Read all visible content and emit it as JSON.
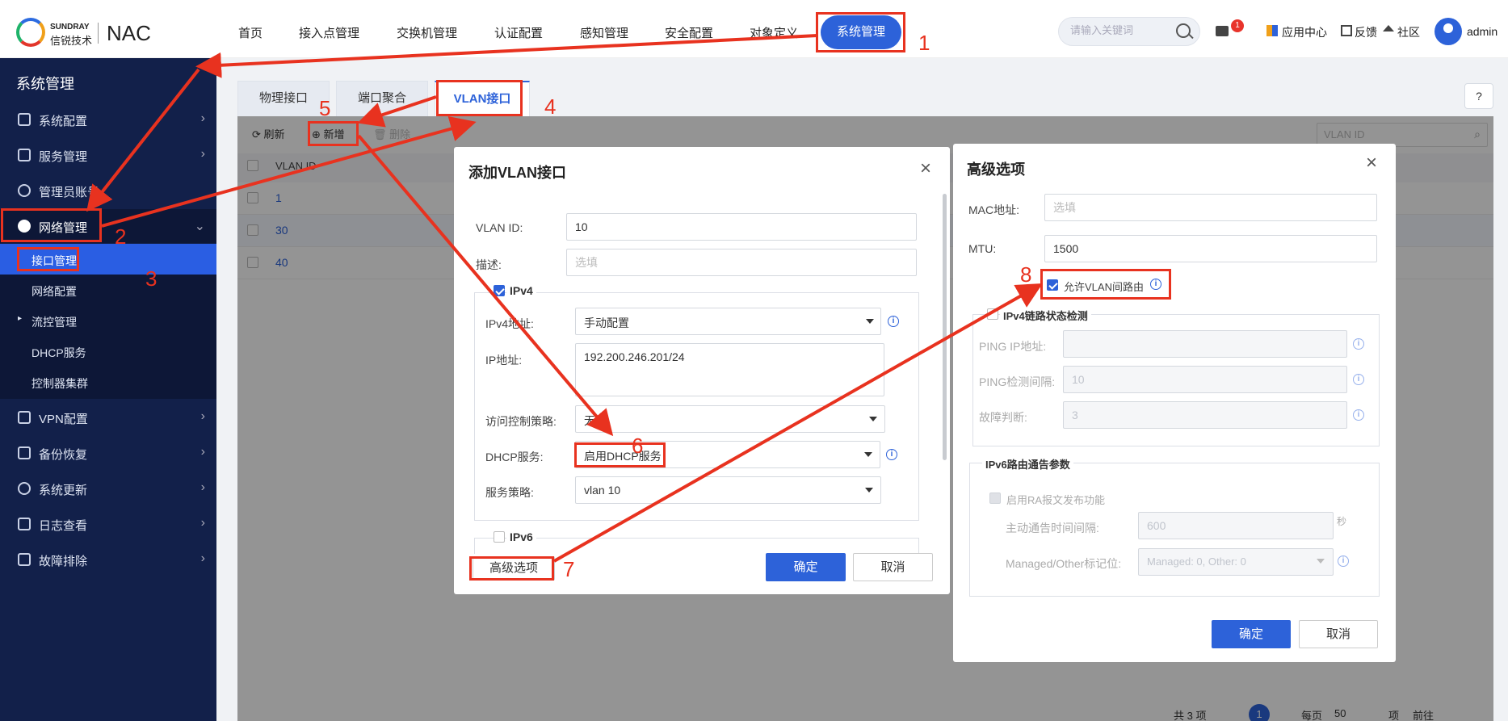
{
  "header": {
    "brand_en": "SUNDRAY",
    "brand_cn": "信锐技术",
    "product": "NAC",
    "nav": [
      "首页",
      "接入点管理",
      "交换机管理",
      "认证配置",
      "感知管理",
      "安全配置",
      "对象定义",
      "系统管理"
    ],
    "active_nav": "系统管理",
    "search_placeholder": "请输入关键词",
    "message_count": "1",
    "app_center": "应用中心",
    "feedback": "反馈",
    "community": "社区",
    "user": "admin"
  },
  "sidebar": {
    "title": "系统管理",
    "items": [
      {
        "label": "系统配置",
        "icon": "settings-icon"
      },
      {
        "label": "服务管理",
        "icon": "server-icon"
      },
      {
        "label": "管理员账号",
        "icon": "user-icon"
      },
      {
        "label": "网络管理",
        "icon": "network-icon"
      },
      {
        "label": "VPN配置",
        "icon": "vpn-icon"
      },
      {
        "label": "备份恢复",
        "icon": "backup-icon"
      },
      {
        "label": "系统更新",
        "icon": "update-icon"
      },
      {
        "label": "日志查看",
        "icon": "log-icon"
      },
      {
        "label": "故障排除",
        "icon": "troubleshoot-icon"
      }
    ],
    "network_sub": [
      "接口管理",
      "网络配置",
      "流控管理",
      "DHCP服务",
      "控制器集群"
    ],
    "active_sub": "接口管理"
  },
  "tabs": [
    "物理接口",
    "端口聚合",
    "VLAN接口"
  ],
  "active_tab": "VLAN接口",
  "toolbar": {
    "refresh": "刷新",
    "add": "新增",
    "delete": "删除",
    "search_placeholder": "VLAN ID"
  },
  "grid": {
    "columns": [
      "VLAN ID"
    ],
    "rows": [
      "1",
      "30",
      "40"
    ]
  },
  "pager": {
    "total": "共 3 项",
    "page": "1",
    "page_size_label": "每页",
    "page_size": "50",
    "unit": "项",
    "goto": "前往"
  },
  "vlan_dialog": {
    "title": "添加VLAN接口",
    "vlan_id_label": "VLAN ID:",
    "vlan_id": "10",
    "desc_label": "描述:",
    "desc_placeholder": "选填",
    "ipv4_legend": "IPv4",
    "ipv4_addr_label": "IPv4地址:",
    "ipv4_addr_mode": "手动配置",
    "ip_label": "IP地址:",
    "ip_value": "192.200.246.201/24",
    "acl_label": "访问控制策略:",
    "acl_value": "无",
    "dhcp_label": "DHCP服务:",
    "dhcp_value": "启用DHCP服务",
    "policy_label": "服务策略:",
    "policy_value": "vlan 10",
    "ipv6_legend": "IPv6",
    "advanced": "高级选项",
    "ok": "确定",
    "cancel": "取消"
  },
  "adv_dialog": {
    "title": "高级选项",
    "mac_label": "MAC地址:",
    "mac_placeholder": "选填",
    "mtu_label": "MTU:",
    "mtu": "1500",
    "allow_vlan_routing": "允许VLAN间路由",
    "link_legend": "IPv4链路状态检测",
    "ping_ip_label": "PING IP地址:",
    "ping_interval_label": "PING检测间隔:",
    "ping_interval": "10",
    "fault_label": "故障判断:",
    "fault_value": "3",
    "ipv6_legend": "IPv6路由通告参数",
    "ra_enable": "启用RA报文发布功能",
    "ra_interval_label": "主动通告时间间隔:",
    "ra_interval": "600",
    "ra_unit": "秒",
    "managed_label": "Managed/Other标记位:",
    "managed_value": "Managed: 0, Other: 0",
    "ok": "确定",
    "cancel": "取消"
  },
  "annotations": [
    "1",
    "2",
    "3",
    "4",
    "5",
    "6",
    "7",
    "8"
  ],
  "colors": {
    "accent": "#2d62d9",
    "sidebar": "#12204a",
    "annotation": "#e8321f"
  }
}
